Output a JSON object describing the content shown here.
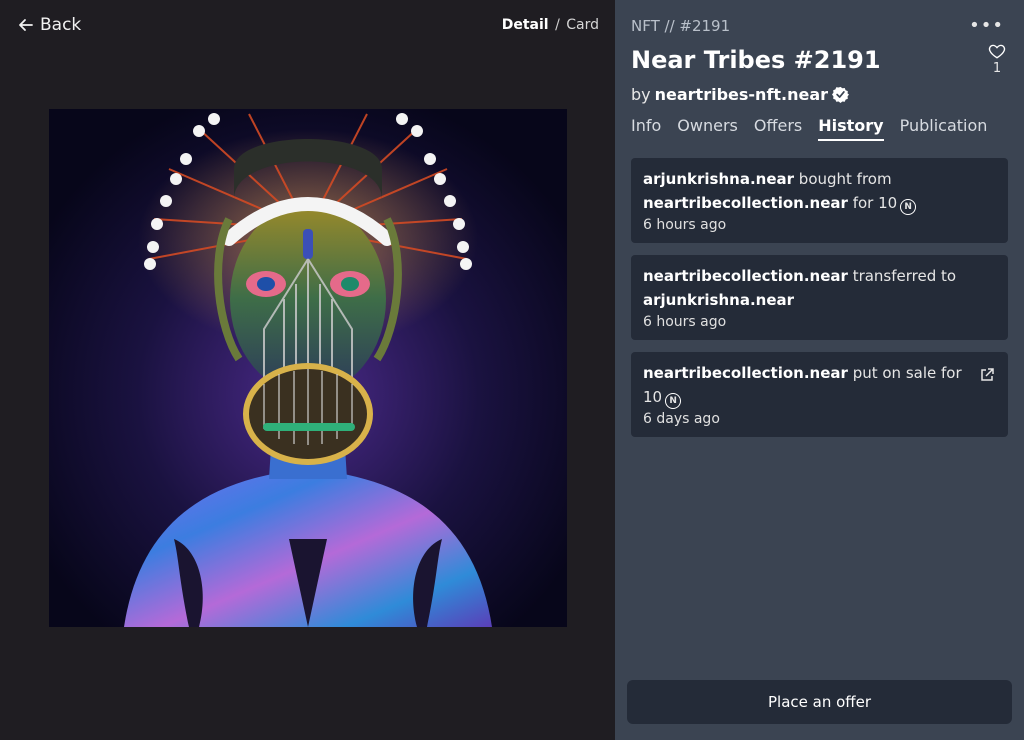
{
  "nav": {
    "back_label": "Back",
    "view_detail": "Detail",
    "view_separator": "/",
    "view_card": "Card"
  },
  "nft": {
    "id_label": "NFT // #2191",
    "title": "Near Tribes #2191",
    "by_prefix": "by",
    "creator": "neartribes-nft.near",
    "likes": "1"
  },
  "tabs": [
    {
      "label": "Info",
      "active": false
    },
    {
      "label": "Owners",
      "active": false
    },
    {
      "label": "Offers",
      "active": false
    },
    {
      "label": "History",
      "active": true
    },
    {
      "label": "Publication",
      "active": false
    }
  ],
  "history": [
    {
      "actor": "arjunkrishna.near",
      "action": "bought from",
      "target": "neartribecollection.near",
      "suffix": "for 10",
      "time": "6 hours ago"
    },
    {
      "actor": "neartribecollection.near",
      "action": "transferred to",
      "target": "arjunkrishna.near",
      "suffix": "",
      "time": "6 hours ago"
    },
    {
      "actor": "neartribecollection.near",
      "action": "put on sale for",
      "target": "",
      "suffix": "10",
      "time": "6 days ago"
    }
  ],
  "actions": {
    "place_offer": "Place an offer"
  },
  "colors": {
    "left_bg": "#1f1d22",
    "right_bg": "#3b4452",
    "card_bg": "#242b38"
  },
  "icons": {
    "back": "arrow-left-icon",
    "more": "more-horizontal-icon",
    "like": "heart-icon",
    "verified": "verified-badge-icon",
    "currency": "near-currency-icon",
    "external": "external-link-icon"
  }
}
